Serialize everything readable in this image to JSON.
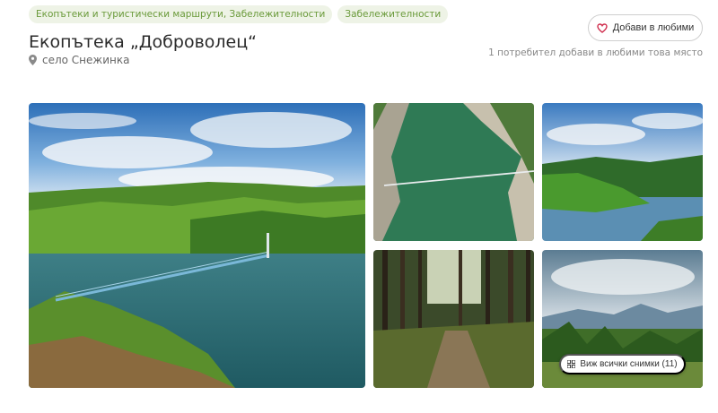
{
  "tags": [
    "Екопътеки и туристически маршрути, Забележителности",
    "Забележителности"
  ],
  "title": "Екопътека „Доброволец“",
  "location": "село Снежинка",
  "favorites": {
    "button_label": "Добави в любими",
    "count_text": "1 потребител добави в любими това място"
  },
  "gallery": {
    "photos": [
      "lake-bridge-photo",
      "river-aerial-photo",
      "mountain-lake-photo",
      "forest-path-photo",
      "mountain-meadow-photo"
    ],
    "view_all_label": "Виж всички снимки (11)"
  },
  "colors": {
    "tag_bg": "#eef3e6",
    "tag_text": "#6a9a3a",
    "heart": "#d0304f"
  },
  "icons": {
    "location": "map-pin-icon",
    "favorite": "heart-icon",
    "gallery": "grid-icon"
  }
}
